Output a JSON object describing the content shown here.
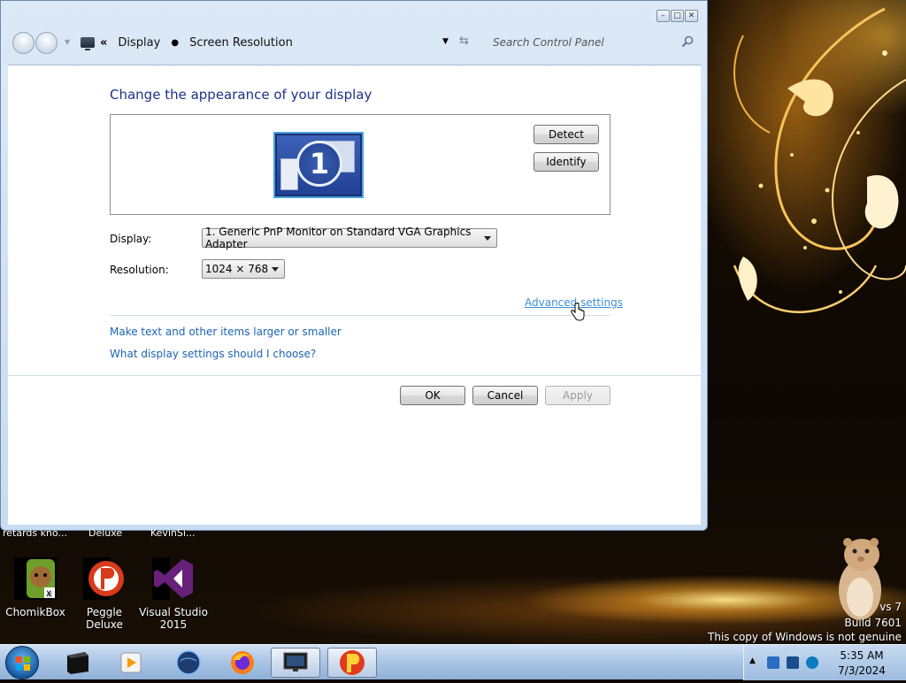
{
  "window": {
    "nav": {
      "breadcrumb": [
        "Display",
        "Screen Resolution"
      ],
      "overflow": "«",
      "search_placeholder": "Search Control Panel"
    },
    "heading": "Change the appearance of your display",
    "monitor_number": "1",
    "buttons": {
      "detect": "Detect",
      "identify": "Identify",
      "ok": "OK",
      "cancel": "Cancel",
      "apply": "Apply"
    },
    "display_label": "Display:",
    "display_value": "1. Generic PnP Monitor on Standard VGA Graphics Adapter",
    "resolution_label": "Resolution:",
    "resolution_value": "1024 × 768",
    "advanced_link": "Advanced settings",
    "links": [
      "Make text and other items larger or smaller",
      "What display settings should I choose?"
    ]
  },
  "desktop": {
    "cut_labels": [
      "retards kno...",
      "Deluxe",
      "KevinSi..."
    ],
    "icons": [
      {
        "label": "ChomikBox"
      },
      {
        "label": "Peggle Deluxe"
      },
      {
        "label": "Visual Studio 2015"
      }
    ],
    "watermark": [
      "vs 7",
      "Build 7601",
      "This copy of Windows is not genuine"
    ]
  },
  "taskbar": {
    "items": [
      "terminal-app",
      "media-player",
      "browser-globe",
      "firefox",
      "display-settings",
      "popcap-game"
    ],
    "clock": {
      "time": "5:35 AM",
      "date": "7/3/2024"
    }
  },
  "colors": {
    "heading": "#1e3287",
    "link": "#1c64b4",
    "taskbar": "#a8c4e4"
  }
}
